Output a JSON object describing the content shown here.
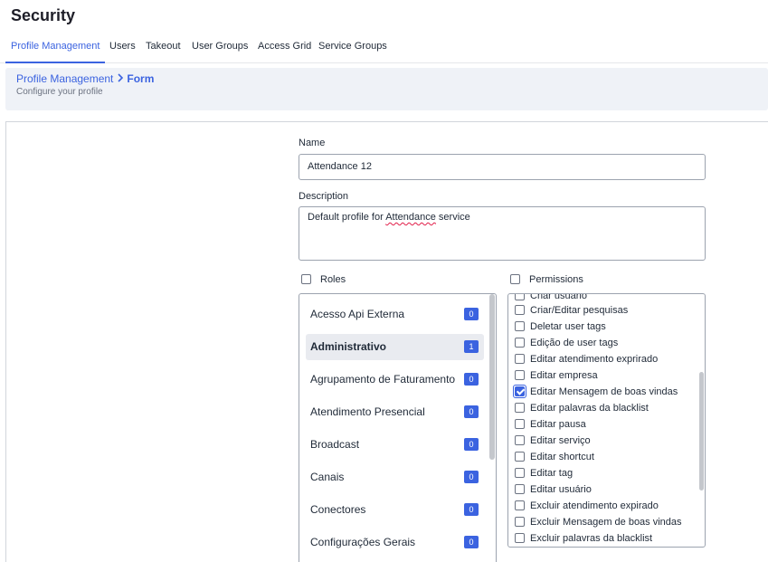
{
  "page": {
    "title": "Security"
  },
  "tabs": [
    {
      "label": "Profile Management",
      "active": true
    },
    {
      "label": "Users",
      "active": false
    },
    {
      "label": "Takeout",
      "active": false
    },
    {
      "label": "User Groups",
      "active": false
    },
    {
      "label": "Access Grid",
      "active": false
    },
    {
      "label": "Service Groups",
      "active": false
    }
  ],
  "breadcrumb": {
    "parent": "Profile Management",
    "current": "Form",
    "subtitle": "Configure your profile"
  },
  "form": {
    "name_label": "Name",
    "name_value": "Attendance 12",
    "description_label": "Description",
    "description_prefix": "Default profile for ",
    "description_misspelled": "Attendance",
    "description_suffix": " service"
  },
  "roles": {
    "header": "Roles",
    "header_checked": false,
    "items": [
      {
        "label": "Acesso Api Externa",
        "count": "0",
        "selected": false
      },
      {
        "label": "Administrativo",
        "count": "1",
        "selected": true
      },
      {
        "label": "Agrupamento de Faturamento",
        "count": "0",
        "selected": false
      },
      {
        "label": "Atendimento Presencial",
        "count": "0",
        "selected": false
      },
      {
        "label": "Broadcast",
        "count": "0",
        "selected": false
      },
      {
        "label": "Canais",
        "count": "0",
        "selected": false
      },
      {
        "label": "Conectores",
        "count": "0",
        "selected": false
      },
      {
        "label": "Configurações Gerais",
        "count": "0",
        "selected": false
      }
    ]
  },
  "permissions": {
    "header": "Permissions",
    "header_checked": false,
    "items": [
      {
        "label": "Criar usuário",
        "checked": false
      },
      {
        "label": "Criar/Editar pesquisas",
        "checked": false
      },
      {
        "label": "Deletar user tags",
        "checked": false
      },
      {
        "label": "Edição de user tags",
        "checked": false
      },
      {
        "label": "Editar atendimento exprirado",
        "checked": false
      },
      {
        "label": "Editar empresa",
        "checked": false
      },
      {
        "label": "Editar Mensagem de boas vindas",
        "checked": true
      },
      {
        "label": "Editar palavras da blacklist",
        "checked": false
      },
      {
        "label": "Editar pausa",
        "checked": false
      },
      {
        "label": "Editar serviço",
        "checked": false
      },
      {
        "label": "Editar shortcut",
        "checked": false
      },
      {
        "label": "Editar tag",
        "checked": false
      },
      {
        "label": "Editar usuário",
        "checked": false
      },
      {
        "label": "Excluir atendimento expirado",
        "checked": false
      },
      {
        "label": "Excluir Mensagem de boas vindas",
        "checked": false
      },
      {
        "label": "Excluir palavras da blacklist",
        "checked": false
      }
    ]
  },
  "colors": {
    "accent": "#3b63e0",
    "banner_bg": "#eff2f7",
    "selected_row_bg": "#e9ebf0"
  }
}
